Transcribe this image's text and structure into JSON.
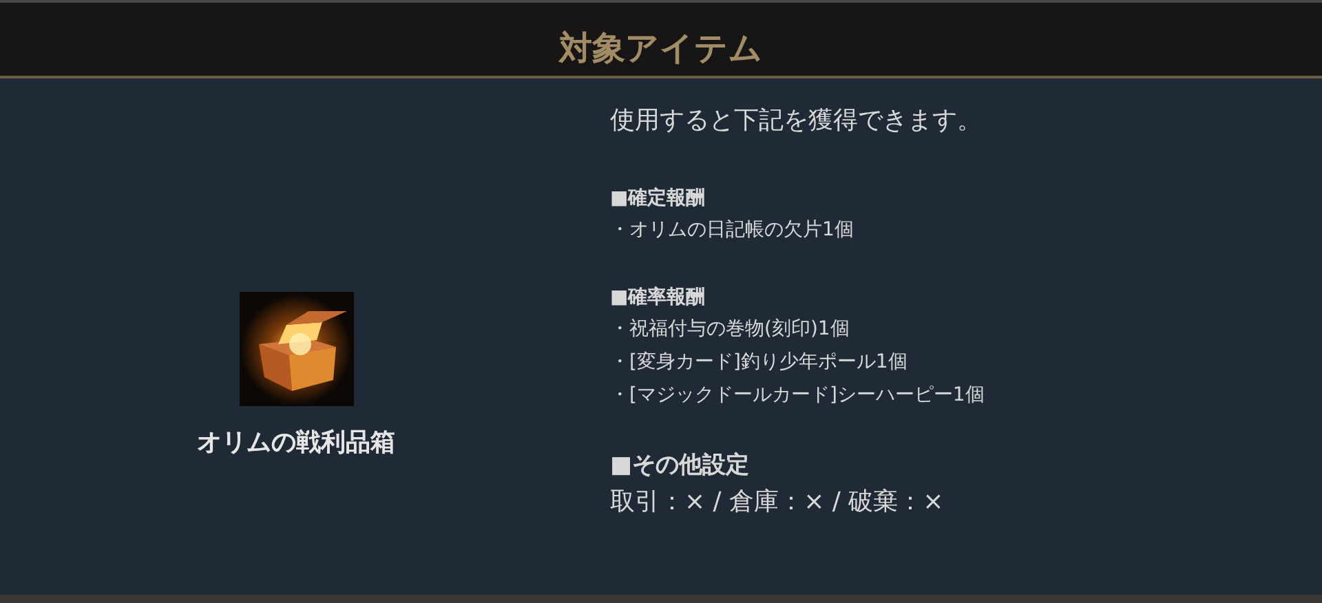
{
  "header": {
    "title": "対象アイテム"
  },
  "item": {
    "name": "オリムの戦利品箱"
  },
  "description": {
    "intro": "使用すると下記を獲得できます。",
    "sections": [
      {
        "kind": "list",
        "heading": "■確定報酬",
        "lines": [
          "・オリムの日記帳の欠片1個"
        ]
      },
      {
        "kind": "list",
        "heading": "■確率報酬",
        "lines": [
          "・祝福付与の巻物(刻印)1個",
          "・[変身カード]釣り少年ポール1個",
          "・[マジックドールカード]シーハーピー1個"
        ]
      },
      {
        "kind": "settings",
        "heading": "■その他設定",
        "lines": [
          "取引：× / 倉庫：× / 破棄：×"
        ]
      }
    ]
  }
}
